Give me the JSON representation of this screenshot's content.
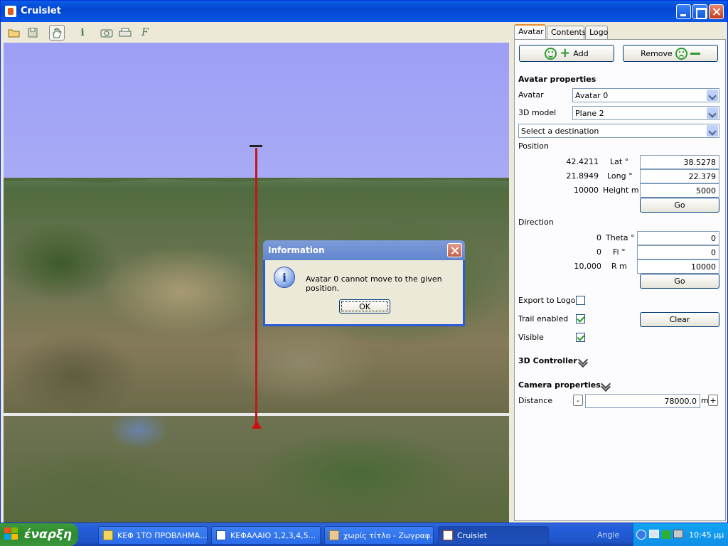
{
  "window": {
    "title": "Cruislet"
  },
  "toolbar": {
    "icons": [
      "open-folder-icon",
      "save-icon",
      "hand-pan-icon",
      "info-icon",
      "camera-icon",
      "printer-icon",
      "function-icon"
    ]
  },
  "dialog": {
    "title": "Information",
    "message": "Avatar 0 cannot move to the given position.",
    "ok_label": "OK"
  },
  "panel": {
    "tabs": [
      "Avatar",
      "Contents",
      "Logo"
    ],
    "add_label": "Add",
    "remove_label": "Remove",
    "avatar_properties_heading": "Avatar properties",
    "avatar_label": "Avatar",
    "avatar_value": "Avatar 0",
    "model_label": "3D model",
    "model_value": "Plane 2",
    "destination_value": "Select a destination",
    "position_heading": "Position",
    "lat_current": "42.4211",
    "lat_label": "Lat °",
    "lat_value": "38.5278",
    "long_current": "21.8949",
    "long_label": "Long °",
    "long_value": "22.379",
    "height_current": "10000",
    "height_label": "Height m",
    "height_value": "5000",
    "go_label": "Go",
    "direction_heading": "Direction",
    "theta_current": "0",
    "theta_label": "Theta °",
    "theta_value": "0",
    "fi_current": "0",
    "fi_label": "Fi °",
    "fi_value": "0",
    "r_current": "10,000",
    "r_label": "R m",
    "r_value": "10000",
    "go2_label": "Go",
    "export_label": "Export to Logo",
    "export_checked": false,
    "trail_label": "Trail enabled",
    "trail_checked": true,
    "clear_label": "Clear",
    "visible_label": "Visible",
    "visible_checked": true,
    "controller_heading": "3D Controller",
    "camera_heading": "Camera properties",
    "distance_label": "Distance",
    "distance_minus": "-",
    "distance_value": "78000.0",
    "distance_unit": "m",
    "distance_plus": "+"
  },
  "taskbar": {
    "start_label": "έναρξη",
    "tasks": [
      "ΚΕΦ 1ΤΟ ΠΡΟΒΛΗΜΑ...",
      "ΚΕΦΑΛΑΙΟ 1,2,3,4,5...",
      "χωρίς τίτλο - Ζωγραφ...",
      "Cruislet"
    ],
    "language": "Angle",
    "clock": "10:45 μμ"
  }
}
